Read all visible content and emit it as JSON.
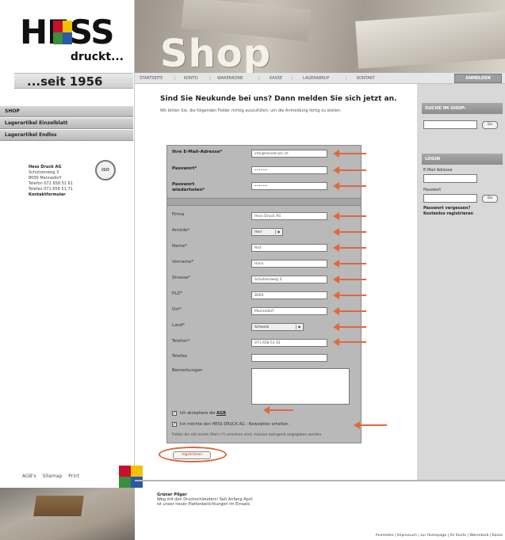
{
  "logo": {
    "brand": "HESS",
    "tagline": "druckt...",
    "since": "...seit 1956"
  },
  "colors": {
    "accent_arrow": "#e0683f",
    "logo_red": "#c8102e",
    "logo_yellow": "#f2c200",
    "logo_green": "#3a8f3a",
    "logo_blue": "#2b58a8"
  },
  "banner": {
    "title": "Shop"
  },
  "topnav": {
    "items": [
      "STARTSEITE",
      "KONTO",
      "WARENKORB",
      "KASSE",
      "LAGERABRUF",
      "KONTAKT"
    ],
    "active": "ANMELDEN"
  },
  "leftnav": {
    "items": [
      "SHOP",
      "Lagerartikel Einzelblatt",
      "Lagerartikel Endlos"
    ]
  },
  "address": {
    "company": "Hess Druck AG",
    "street": "Schutzenweg 3",
    "city": "8000 Mannedorf",
    "phone": "Telefon 071 658 51 61",
    "fax": "Telefax 071 658 51 71",
    "contact": "Kontaktformular",
    "seal": "ISO"
  },
  "footer_links": [
    "AGB's",
    "Sitemap",
    "Print"
  ],
  "main": {
    "headline": "Sind Sie Neukunde bei uns? Dann melden Sie sich jetzt an.",
    "intro": "Wir bitten Sie, die folgenden Felder richtig auszufüllen, um die Anmeldung fertig zu stellen."
  },
  "form": {
    "account_fields": [
      {
        "label": "Ihre E-Mail-Adresse*",
        "value": "info@hessdruck.ch",
        "bold": true
      },
      {
        "label": "Passwort*",
        "value": "••••••",
        "bold": true
      },
      {
        "label": "Passwort wiederholen*",
        "value": "••••••",
        "bold": true
      }
    ],
    "personal_fields": [
      {
        "label": "Firma",
        "value": "Hess Druck AG",
        "type": "text"
      },
      {
        "label": "Anrede*",
        "value": "Herr",
        "type": "select"
      },
      {
        "label": "Name*",
        "value": "Rist",
        "type": "text"
      },
      {
        "label": "Vorname*",
        "value": "Hans",
        "type": "text"
      },
      {
        "label": "Strasse*",
        "value": "Schutzenweg 3",
        "type": "text"
      },
      {
        "label": "PLZ*",
        "value": "8000",
        "type": "text"
      },
      {
        "label": "Ort*",
        "value": "Mannedorf",
        "type": "text"
      },
      {
        "label": "Land*",
        "value": "Schweiz",
        "type": "select"
      },
      {
        "label": "Telefon*",
        "value": "071 658 51 61",
        "type": "text"
      },
      {
        "label": "Telefax",
        "value": "",
        "type": "text"
      }
    ],
    "remarks_label": "Bemerkungen",
    "agb_prefix": "Ich akzeptiere die",
    "agb_link": "AGB",
    "newsletter_label": "Ich möchte den HESS DRUCK AG - Newsletter erhalten.",
    "required_note": "Felder die mit einem Stern (*) versehen sind, müssen zwingend angegeben werden.",
    "submit_label": "registrieren"
  },
  "right": {
    "search_title": "SUCHE IM SHOP:",
    "go_label": "Go",
    "login_title": "LOGIN",
    "email_label": "E-Mail Adresse",
    "password_label": "Passwort",
    "forgot_link": "Passwort vergessen?",
    "register_link": "Kostenlos registrieren"
  },
  "news": {
    "title": "Grüner Pilger",
    "line1": "Weg mit den Druckschleuders! Seit Anfang April",
    "line2": "ist unser neuer Plattenbelichtungen im Einsatz."
  },
  "bottombar": "Anmelden | Impressum | zur Homepage | Ihr Konto | Warenkorb | Kasse"
}
